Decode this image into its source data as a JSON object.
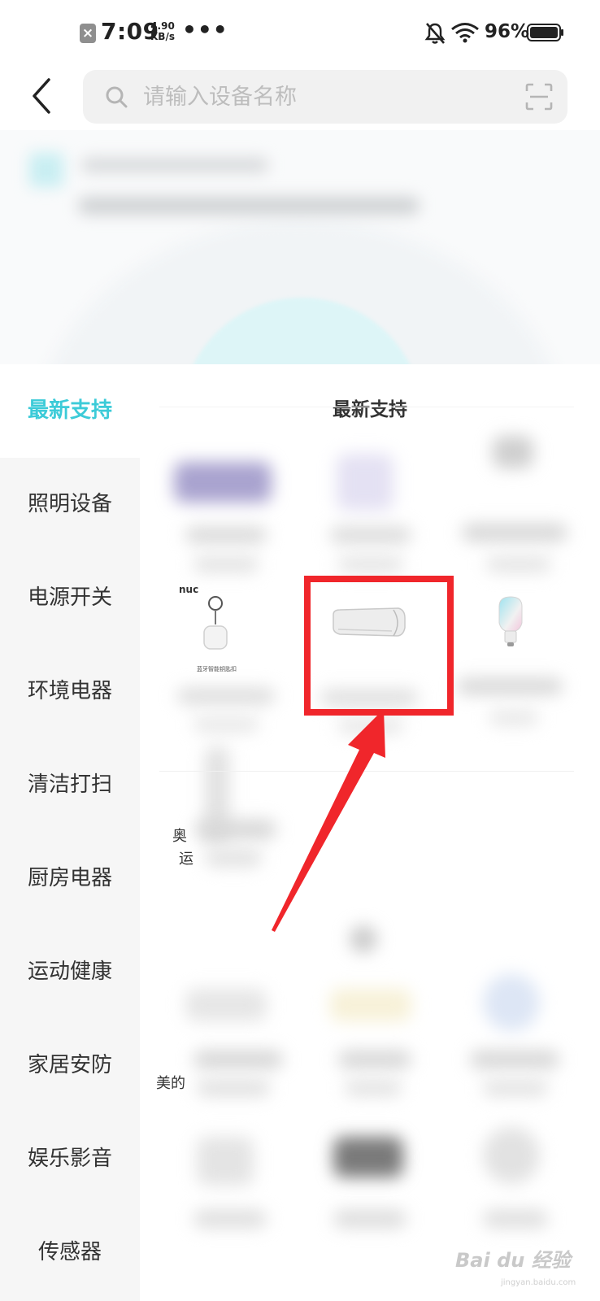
{
  "status_bar": {
    "time": "7:09",
    "speed_value": "4.90",
    "speed_unit": "KB/s",
    "more": "•••",
    "battery": "96%"
  },
  "header": {
    "search_placeholder": "请输入设备名称"
  },
  "categories": [
    {
      "label": "最新支持",
      "active": true
    },
    {
      "label": "照明设备",
      "active": false
    },
    {
      "label": "电源开关",
      "active": false
    },
    {
      "label": "环境电器",
      "active": false
    },
    {
      "label": "清洁打扫",
      "active": false
    },
    {
      "label": "厨房电器",
      "active": false
    },
    {
      "label": "运动健康",
      "active": false
    },
    {
      "label": "家居安防",
      "active": false
    },
    {
      "label": "娱乐影音",
      "active": false
    },
    {
      "label": "传感器",
      "active": false
    }
  ],
  "content": {
    "title": "最新支持",
    "partial_labels": [
      "奥",
      "运",
      "美的"
    ],
    "product_caption_tiny": "蓝牙智能钥匙扣",
    "nuc_logo": "nuc"
  },
  "watermark": {
    "text": "Bai du 经验",
    "sub": "jingyan.baidu.com"
  },
  "colors": {
    "accent": "#3ccbd8",
    "annotation_red": "#f0262b"
  }
}
